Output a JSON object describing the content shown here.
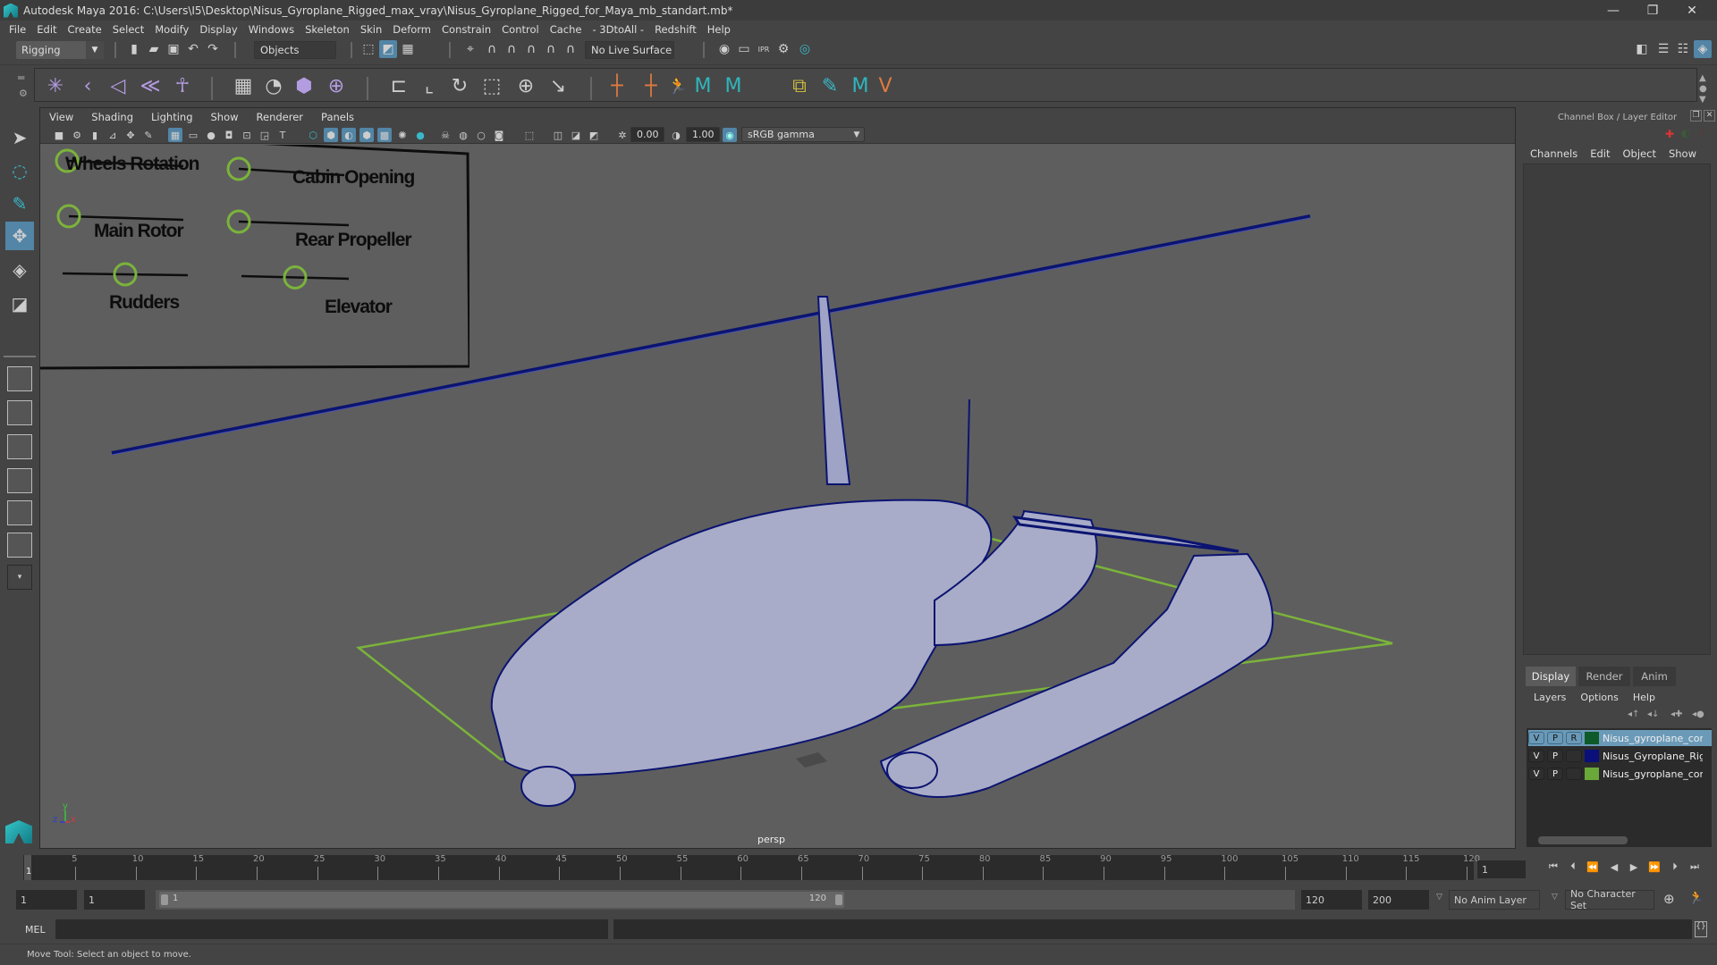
{
  "window": {
    "title": "Autodesk Maya 2016: C:\\Users\\I5\\Desktop\\Nisus_Gyroplane_Rigged_max_vray\\Nisus_Gyroplane_Rigged_for_Maya_mb_standart.mb*",
    "minimize": "—",
    "maximize": "❐",
    "close": "✕"
  },
  "menubar": [
    "File",
    "Edit",
    "Create",
    "Select",
    "Modify",
    "Display",
    "Windows",
    "Skeleton",
    "Skin",
    "Deform",
    "Constrain",
    "Control",
    "Cache",
    "- 3DtoAll -",
    "Redshift",
    "Help"
  ],
  "shelf1": {
    "mode": "Rigging",
    "selection_mask": "Objects",
    "live_surface": "No Live Surface"
  },
  "shelf2": {
    "icons": [
      "joint-tool-icon",
      "ik-handle-icon",
      "ik-spline-icon",
      "insert-joint-icon",
      "humanik-icon",
      "paint-weights-icon",
      "sculpt-deformer-icon",
      "lattice-icon",
      "cluster-icon",
      "parent-constraint-icon",
      "point-constraint-icon",
      "orient-constraint-icon",
      "scale-constraint-icon",
      "aim-constraint-icon",
      "pole-vector-icon",
      "locator-icon",
      "parent-locator-icon",
      "character-icon",
      "maya-icon-1",
      "maya-icon-2",
      "layer-tool-icon",
      "paint-select-icon",
      "maya-icon-3",
      "vertex-icon"
    ]
  },
  "viewport": {
    "menu": [
      "View",
      "Shading",
      "Lighting",
      "Show",
      "Renderer",
      "Panels"
    ],
    "exposure": "0.00",
    "gamma": "1.00",
    "color_space": "sRGB gamma",
    "camera_label": "persp",
    "axis": {
      "x": "x",
      "y": "y",
      "z": "z"
    }
  },
  "control_panel": {
    "controls": [
      {
        "label": "Wheels Rotation",
        "value": 0.0
      },
      {
        "label": "Cabin Opening",
        "value": 0.0
      },
      {
        "label": "Main Rotor",
        "value": 0.0
      },
      {
        "label": "Rear Propeller",
        "value": 0.0
      },
      {
        "label": "Rudders",
        "value": 0.5
      },
      {
        "label": "Elevator",
        "value": 0.5
      }
    ]
  },
  "channel_box": {
    "title": "Channel Box / Layer Editor",
    "menu": [
      "Channels",
      "Edit",
      "Object",
      "Show"
    ]
  },
  "layer_editor": {
    "tabs": [
      "Display",
      "Render",
      "Anim"
    ],
    "active_tab": "Display",
    "menu": [
      "Layers",
      "Options",
      "Help"
    ],
    "layers": [
      {
        "v": "V",
        "p": "P",
        "r": "R",
        "color": "#0e5a2a",
        "name": "Nisus_gyroplane_controllers",
        "selected": true
      },
      {
        "v": "V",
        "p": "P",
        "r": "",
        "color": "#0a0f7a",
        "name": "Nisus_Gyroplane_Rigged",
        "selected": false
      },
      {
        "v": "V",
        "p": "P",
        "r": "",
        "color": "#6aa83a",
        "name": "Nisus_gyroplane_controllers",
        "selected": false
      }
    ]
  },
  "timeline": {
    "ticks": [
      5,
      10,
      15,
      20,
      25,
      30,
      35,
      40,
      45,
      50,
      55,
      60,
      65,
      70,
      75,
      80,
      85,
      90,
      95,
      100,
      105,
      110,
      115,
      120
    ],
    "current_frame_marker": "1",
    "current_frame": "1",
    "range_start": "1",
    "playback_start": "1",
    "range_slider_start": "1",
    "range_slider_end": "120",
    "playback_end": "120",
    "range_end": "200",
    "anim_layer": "No Anim Layer",
    "character_set": "No Character Set"
  },
  "command_line": {
    "label": "MEL"
  },
  "status": {
    "help_line": "Move Tool: Select an object to move."
  },
  "colors": {
    "accent": "#5285a6",
    "control_green": "#7bb33b",
    "wireframe": "#0b1470"
  }
}
